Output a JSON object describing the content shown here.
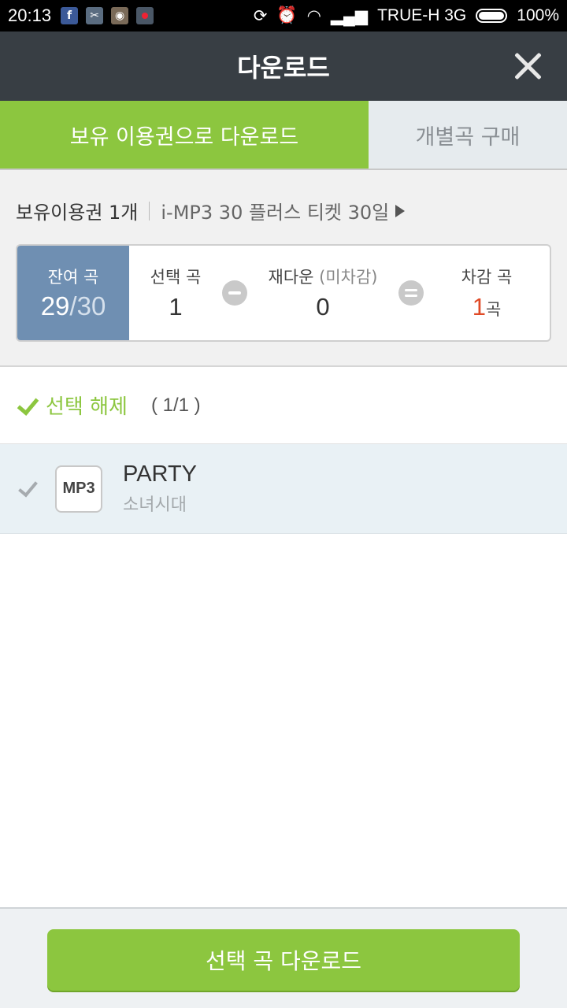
{
  "status_bar": {
    "time": "20:13",
    "carrier": "TRUE-H 3G",
    "battery": "100%",
    "notification_icons": [
      "facebook-icon",
      "scissors-icon",
      "instagram-icon",
      "record-icon"
    ],
    "system_icons": [
      "sync-icon",
      "alarm-icon",
      "wifi-icon",
      "signal-icon",
      "battery-icon"
    ]
  },
  "header": {
    "title": "다운로드"
  },
  "tabs": [
    {
      "label": "보유 이용권으로 다운로드",
      "active": true
    },
    {
      "label": "개별곡 구매",
      "active": false
    }
  ],
  "ticket": {
    "owned": "보유이용권 1개",
    "plan": "i-MP3 30 플러스 티켓 30일"
  },
  "counter": {
    "remaining_label": "잔여 곡",
    "remaining_value": "29",
    "remaining_total": "/30",
    "selected_label": "선택 곡",
    "selected_value": "1",
    "redownload_label": "재다운",
    "redownload_sub": " (미차감)",
    "redownload_value": "0",
    "deduct_label": "차감 곡",
    "deduct_value": "1",
    "deduct_unit": "곡"
  },
  "selection": {
    "deselect_label": "선택 해제",
    "count": "( 1/1 )"
  },
  "songs": [
    {
      "title": "PARTY",
      "artist": "소녀시대",
      "format": "MP3",
      "checked": true
    }
  ],
  "footer": {
    "download_label": "선택 곡 다운로드"
  },
  "colors": {
    "accent_green": "#8cc63f",
    "header_dark": "#383e44",
    "remain_blue": "#6f8fb2",
    "highlight_red": "#e04a26"
  }
}
